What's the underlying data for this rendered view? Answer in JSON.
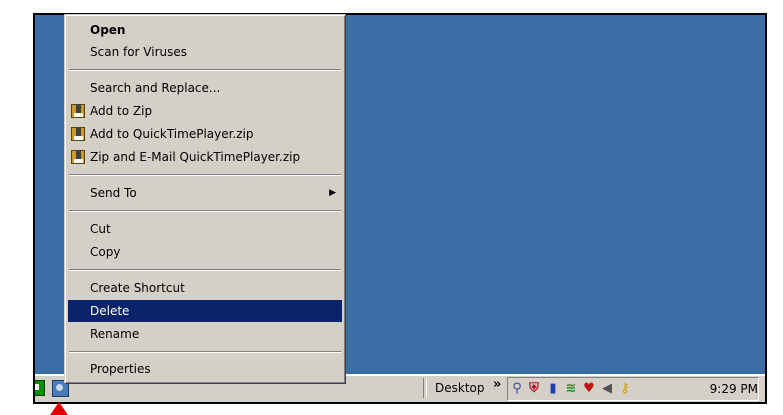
{
  "menu": {
    "items": [
      {
        "label": "Open"
      },
      {
        "label": "Scan for Viruses"
      },
      {
        "label": "Search and Replace..."
      },
      {
        "label": "Add to Zip"
      },
      {
        "label": "Add to QuickTimePlayer.zip"
      },
      {
        "label": "Zip and E-Mail QuickTimePlayer.zip"
      },
      {
        "label": "Send To"
      },
      {
        "label": "Cut"
      },
      {
        "label": "Copy"
      },
      {
        "label": "Create Shortcut"
      },
      {
        "label": "Delete"
      },
      {
        "label": "Rename"
      },
      {
        "label": "Properties"
      }
    ],
    "submenu_arrow": "▶"
  },
  "taskbar": {
    "desktop_label": "Desktop",
    "chevron": "»",
    "clock": "9:29 PM",
    "tray_icons": [
      "magnifier-network-icon",
      "shield-virus-icon",
      "antivirus-icon",
      "network-monitor-icon",
      "security-shield-icon",
      "volume-icon",
      "key-x-icon"
    ]
  },
  "colors": {
    "desktop": "#3a6ea5",
    "menu_bg": "#d4d0c8",
    "selection": "#0a246a",
    "pointer": "#e00000"
  }
}
